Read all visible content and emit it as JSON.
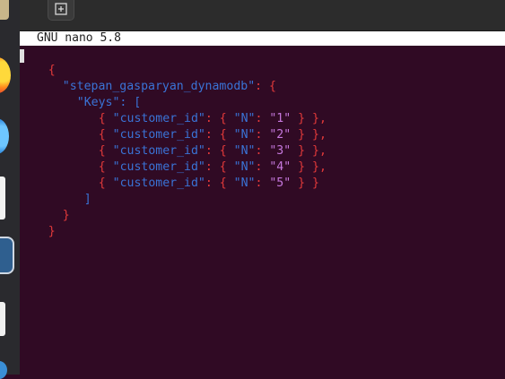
{
  "terminal": {
    "new_tab_icon": "new-tab-icon",
    "nano_header": "GNU nano 5.8"
  },
  "json_file": {
    "open_brace": "{",
    "table_name": "\"stepan_gasparyan_dynamodb\"",
    "keys_label": "\"Keys\"",
    "key_field": "\"customer_id\"",
    "type_field": "\"N\"",
    "values": [
      "\"1\"",
      "\"2\"",
      "\"3\"",
      "\"4\"",
      "\"5\""
    ],
    "close_brace": "}"
  },
  "colors": {
    "background": "#300a24",
    "brace": "#e33a3a",
    "key": "#3a73d6",
    "value": "#c678dd"
  }
}
